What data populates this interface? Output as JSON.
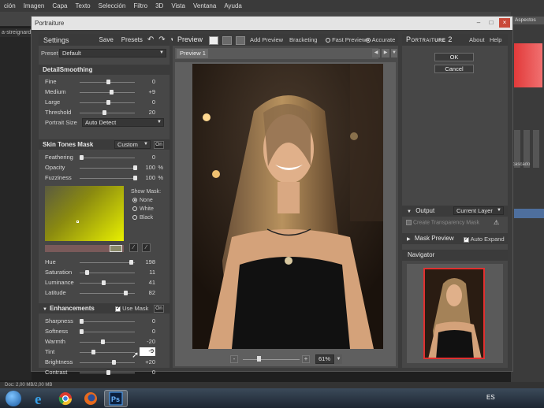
{
  "ps": {
    "menu": [
      "ción",
      "Imagen",
      "Capa",
      "Texto",
      "Selección",
      "Filtro",
      "3D",
      "Vista",
      "Ventana",
      "Ayuda"
    ],
    "doc_tab": "a-streignard.",
    "aspect_label": "Aspectos",
    "cascade_label": "cascado",
    "status": "Doc: 2,00 MB/2,00 MB",
    "lang": "ES"
  },
  "dialog": {
    "title": "Portraiture",
    "settings": {
      "title": "Settings",
      "save": "Save",
      "presets": "Presets",
      "preset_label": "Preset",
      "preset_value": "Default"
    },
    "detail": {
      "title": "DetailSmoothing",
      "fine": {
        "label": "Fine",
        "value": "0",
        "pos": 0.5
      },
      "medium": {
        "label": "Medium",
        "value": "+9",
        "pos": 0.56
      },
      "large": {
        "label": "Large",
        "value": "0",
        "pos": 0.5
      },
      "threshold": {
        "label": "Threshold",
        "value": "20",
        "pos": 0.42
      },
      "portrait_size_label": "Portrait Size",
      "portrait_size_value": "Auto Detect"
    },
    "skin": {
      "title": "Skin Tones Mask",
      "mode": "Custom",
      "on": "On",
      "feathering": {
        "label": "Feathering",
        "value": "0",
        "pos": 0.0
      },
      "opacity": {
        "label": "Opacity",
        "value": "100",
        "unit": "%",
        "pos": 1.0
      },
      "fuzziness": {
        "label": "Fuzziness",
        "value": "100",
        "unit": "%",
        "pos": 1.0
      },
      "show_mask_label": "Show Mask:",
      "show_mask_options": [
        "None",
        "White",
        "Black"
      ],
      "hue": {
        "label": "Hue",
        "value": "198",
        "pos": 0.92
      },
      "saturation": {
        "label": "Saturation",
        "value": "11",
        "pos": 0.11
      },
      "luminance": {
        "label": "Luminance",
        "value": "41",
        "pos": 0.41
      },
      "latitude": {
        "label": "Latitude",
        "value": "82",
        "pos": 0.82
      }
    },
    "enh": {
      "title": "Enhancements",
      "use_mask": "Use Mask",
      "on": "On",
      "sharpness": {
        "label": "Sharpness",
        "value": "0",
        "pos": 0.0
      },
      "softness": {
        "label": "Softness",
        "value": "0",
        "pos": 0.0
      },
      "warmth": {
        "label": "Warmth",
        "value": "-20",
        "pos": 0.4
      },
      "tint": {
        "label": "Tint",
        "value": "-9",
        "pos": 0.22
      },
      "brightness": {
        "label": "Brightness",
        "value": "+20",
        "pos": 0.6
      },
      "contrast": {
        "label": "Contrast",
        "value": "0",
        "pos": 0.5
      }
    },
    "preview": {
      "title": "Preview",
      "add_preview": "Add Preview",
      "bracketing": "Bracketing",
      "fast_preview": "Fast Preview",
      "accurate": "Accurate",
      "tab": "Preview 1",
      "zoom": "61%"
    },
    "right": {
      "brand_a": "Portrait",
      "brand_b": "ure",
      "brand_ver": "2",
      "about": "About",
      "help": "Help",
      "ok": "OK",
      "cancel": "Cancel",
      "output_label": "Output",
      "output_value": "Current Layer",
      "transparency_mask": "Create Transparency Mask",
      "mask_preview": "Mask Preview",
      "auto_expand": "Auto Expand",
      "navigator": "Navigator"
    }
  },
  "colors": {
    "dialog_bg": "#3c3c3c",
    "panel_bg": "#474747",
    "accent_red": "#e03030",
    "mask_yellow": "#e8f000"
  }
}
